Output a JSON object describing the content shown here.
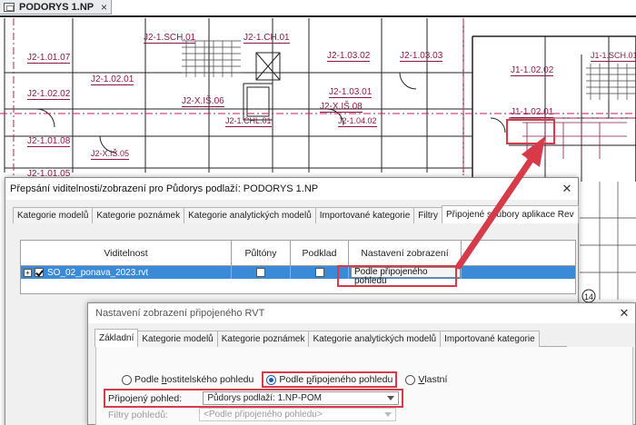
{
  "document_tab": {
    "title": "PODORYS 1.NP",
    "close": "×"
  },
  "drawing": {
    "room_tags": [
      "J2-1.01.07",
      "J2-1.SCH.01",
      "J2-1.CH.01",
      "J2-1.03.02",
      "J2-1.03.03",
      "J1-1.02.02",
      "J1-1.SCH.01",
      "J2-1.02.02",
      "J2-X.IŠ.06",
      "J2-1.02.01",
      "J2-1.CHL.01",
      "J2-1.03.01",
      "J2-X.IŠ.08",
      "J2-1.04.02",
      "J1-1.02.01",
      "J2-1.01.08",
      "J2-1.01.05",
      "J2-X.IŠ.05"
    ],
    "grid_bubble": "14"
  },
  "dialog1": {
    "title": "Přepsání viditelnosti/zobrazení pro Půdorys podlaží: PODORYS 1.NP",
    "close": "✕",
    "tabs": [
      "Kategorie modelů",
      "Kategorie poznámek",
      "Kategorie analytických modelů",
      "Importované kategorie",
      "Filtry",
      "Připojené soubory aplikace Rev"
    ],
    "columns": [
      "Viditelnost",
      "Půltóny",
      "Podklad",
      "Nastavení zobrazení"
    ],
    "rows": [
      {
        "expander": "+",
        "name": "SO_02_ponava_2023.rvt",
        "display": "Podle připojeného pohledu"
      }
    ]
  },
  "dialog2": {
    "title": "Nastavení zobrazení připojeného RVT",
    "close": "✕",
    "tabs": [
      "Základní",
      "Kategorie modelů",
      "Kategorie poznámek",
      "Kategorie analytických modelů",
      "Importované kategorie"
    ],
    "radios": [
      {
        "pre": "Podle ",
        "u": "h",
        "post": "ostitelského pohledu"
      },
      {
        "pre": "Podle ",
        "u": "p",
        "post": "řipojeného pohledu"
      },
      {
        "pre": "",
        "u": "V",
        "post": "lastní"
      }
    ],
    "linked_view_label": "Připojený pohled:",
    "linked_view_value": "Půdorys podlaží: 1.NP-POM",
    "filters_label": "Filtry pohledů:",
    "filters_value": "<Podle připojeného pohledu>"
  },
  "colors": {
    "highlight": "#d73a49",
    "selection": "#3a8ad8",
    "tag": "#8b1a4a"
  }
}
